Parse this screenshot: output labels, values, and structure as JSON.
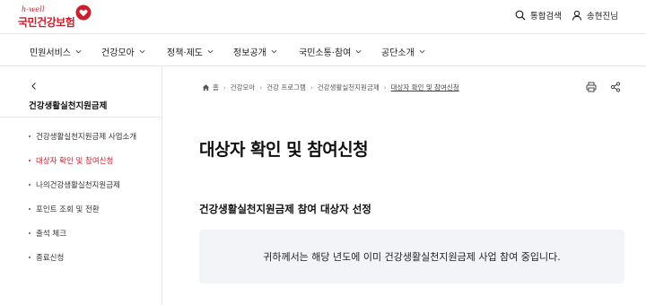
{
  "header": {
    "logo_tagline": "h-well",
    "logo_name": "국민건강보험",
    "search_label": "통합검색",
    "user_label": "송현진님"
  },
  "gnb": {
    "items": [
      {
        "label": "민원서비스"
      },
      {
        "label": "건강모아"
      },
      {
        "label": "정책·제도"
      },
      {
        "label": "정보공개"
      },
      {
        "label": "국민소통·참여"
      },
      {
        "label": "공단소개"
      }
    ]
  },
  "sidebar": {
    "title": "건강생활실천지원금제",
    "items": [
      {
        "label": "건강생활실천지원금제 사업소개",
        "active": false
      },
      {
        "label": "대상자 확인 및 참여신청",
        "active": true
      },
      {
        "label": "나의건강생활실천지원금제",
        "active": false
      },
      {
        "label": "포인트 조회 및 전환",
        "active": false
      },
      {
        "label": "출석 체크",
        "active": false
      },
      {
        "label": "종료신청",
        "active": false
      }
    ]
  },
  "breadcrumb": {
    "items": [
      "홈",
      "건강모아",
      "건강 프로그램",
      "건강생활실천지원금제",
      "대상자 확인 및 참여신청"
    ]
  },
  "main": {
    "page_title": "대상자 확인 및 참여신청",
    "section_title": "건강생활실천지원금제 참여 대상자 선정",
    "notice_text": "귀하께서는 해당 년도에 이미 건강생활실천지원금제 사업 참여 중입니다."
  },
  "colors": {
    "brand": "#c8202f",
    "notice_bg": "#f2f4f8"
  }
}
